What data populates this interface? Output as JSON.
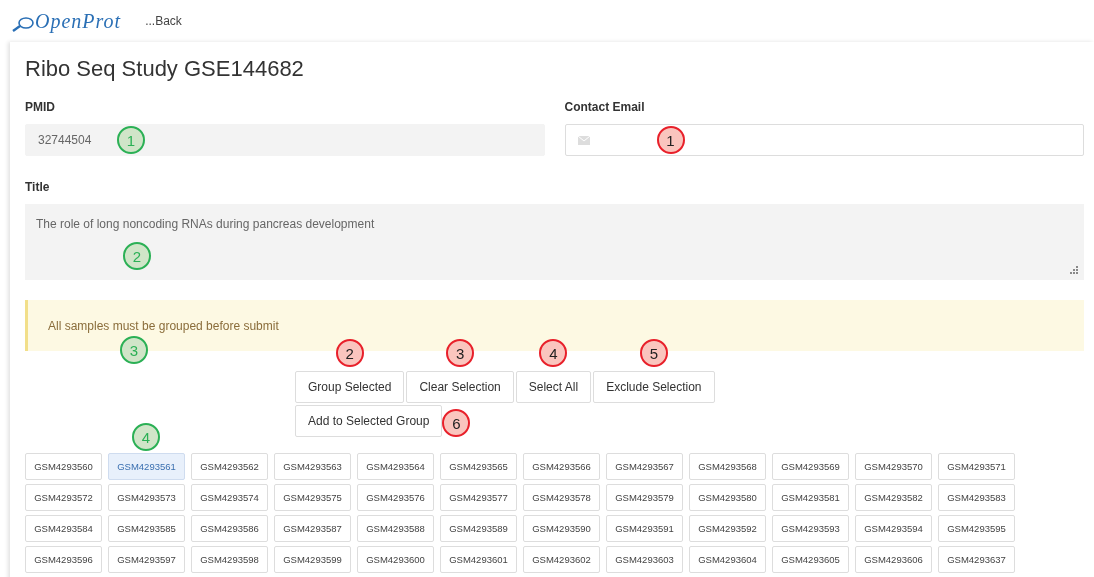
{
  "logo": "OpenProt",
  "back_link": "...Back",
  "heading": "Ribo Seq Study GSE144682",
  "pmid": {
    "label": "PMID",
    "value": "32744504",
    "disabled": true,
    "callout": {
      "number": "1",
      "kind": "note",
      "color": "#2bb055"
    }
  },
  "contact_email": {
    "label": "Contact Email",
    "disabled": false,
    "callout": {
      "number": "1",
      "kind": "issue",
      "color": "#e8202a"
    }
  },
  "title": {
    "label": "Title",
    "value": "The role of long noncoding RNAs during pancreas development",
    "disabled": true,
    "callout": {
      "number": "2",
      "kind": "note",
      "color": "#2bb055"
    }
  },
  "alert": {
    "text": "All samples must be grouped before submit",
    "callout": {
      "number": "3",
      "kind": "note",
      "color": "#2bb055"
    }
  },
  "actions": [
    {
      "label": "Group Selected",
      "callout": {
        "number": "2",
        "kind": "issue",
        "color": "#e8202a"
      }
    },
    {
      "label": "Clear Selection",
      "callout": {
        "number": "3",
        "kind": "issue",
        "color": "#e8202a"
      }
    },
    {
      "label": "Select All",
      "callout": {
        "number": "4",
        "kind": "issue",
        "color": "#e8202a"
      }
    },
    {
      "label": "Exclude Selection",
      "callout": {
        "number": "5",
        "kind": "issue",
        "color": "#e8202a"
      }
    },
    {
      "label": "Add to Selected Group",
      "callout": {
        "number": "6",
        "kind": "issue",
        "color": "#e8202a"
      }
    }
  ],
  "samples": [
    {
      "label": "GSM4293560",
      "selected": false
    },
    {
      "label": "GSM4293561",
      "selected": true,
      "callout": {
        "number": "4",
        "kind": "note",
        "color": "#2bb055"
      }
    },
    {
      "label": "GSM4293562",
      "selected": false
    },
    {
      "label": "GSM4293563",
      "selected": false
    },
    {
      "label": "GSM4293564",
      "selected": false
    },
    {
      "label": "GSM4293565",
      "selected": false
    },
    {
      "label": "GSM4293566",
      "selected": false
    },
    {
      "label": "GSM4293567",
      "selected": false
    },
    {
      "label": "GSM4293568",
      "selected": false
    },
    {
      "label": "GSM4293569",
      "selected": false
    },
    {
      "label": "GSM4293570",
      "selected": false
    },
    {
      "label": "GSM4293571",
      "selected": false
    },
    {
      "label": "GSM4293572",
      "selected": false
    },
    {
      "label": "GSM4293573",
      "selected": false
    },
    {
      "label": "GSM4293574",
      "selected": false
    },
    {
      "label": "GSM4293575",
      "selected": false
    },
    {
      "label": "GSM4293576",
      "selected": false
    },
    {
      "label": "GSM4293577",
      "selected": false
    },
    {
      "label": "GSM4293578",
      "selected": false
    },
    {
      "label": "GSM4293579",
      "selected": false
    },
    {
      "label": "GSM4293580",
      "selected": false
    },
    {
      "label": "GSM4293581",
      "selected": false
    },
    {
      "label": "GSM4293582",
      "selected": false
    },
    {
      "label": "GSM4293583",
      "selected": false
    },
    {
      "label": "GSM4293584",
      "selected": false
    },
    {
      "label": "GSM4293585",
      "selected": false
    },
    {
      "label": "GSM4293586",
      "selected": false
    },
    {
      "label": "GSM4293587",
      "selected": false
    },
    {
      "label": "GSM4293588",
      "selected": false
    },
    {
      "label": "GSM4293589",
      "selected": false
    },
    {
      "label": "GSM4293590",
      "selected": false
    },
    {
      "label": "GSM4293591",
      "selected": false
    },
    {
      "label": "GSM4293592",
      "selected": false
    },
    {
      "label": "GSM4293593",
      "selected": false
    },
    {
      "label": "GSM4293594",
      "selected": false
    },
    {
      "label": "GSM4293595",
      "selected": false
    },
    {
      "label": "GSM4293596",
      "selected": false
    },
    {
      "label": "GSM4293597",
      "selected": false
    },
    {
      "label": "GSM4293598",
      "selected": false
    },
    {
      "label": "GSM4293599",
      "selected": false
    },
    {
      "label": "GSM4293600",
      "selected": false
    },
    {
      "label": "GSM4293601",
      "selected": false
    },
    {
      "label": "GSM4293602",
      "selected": false
    },
    {
      "label": "GSM4293603",
      "selected": false
    },
    {
      "label": "GSM4293604",
      "selected": false
    },
    {
      "label": "GSM4293605",
      "selected": false
    },
    {
      "label": "GSM4293606",
      "selected": false
    },
    {
      "label": "GSM4293637",
      "selected": false
    }
  ]
}
